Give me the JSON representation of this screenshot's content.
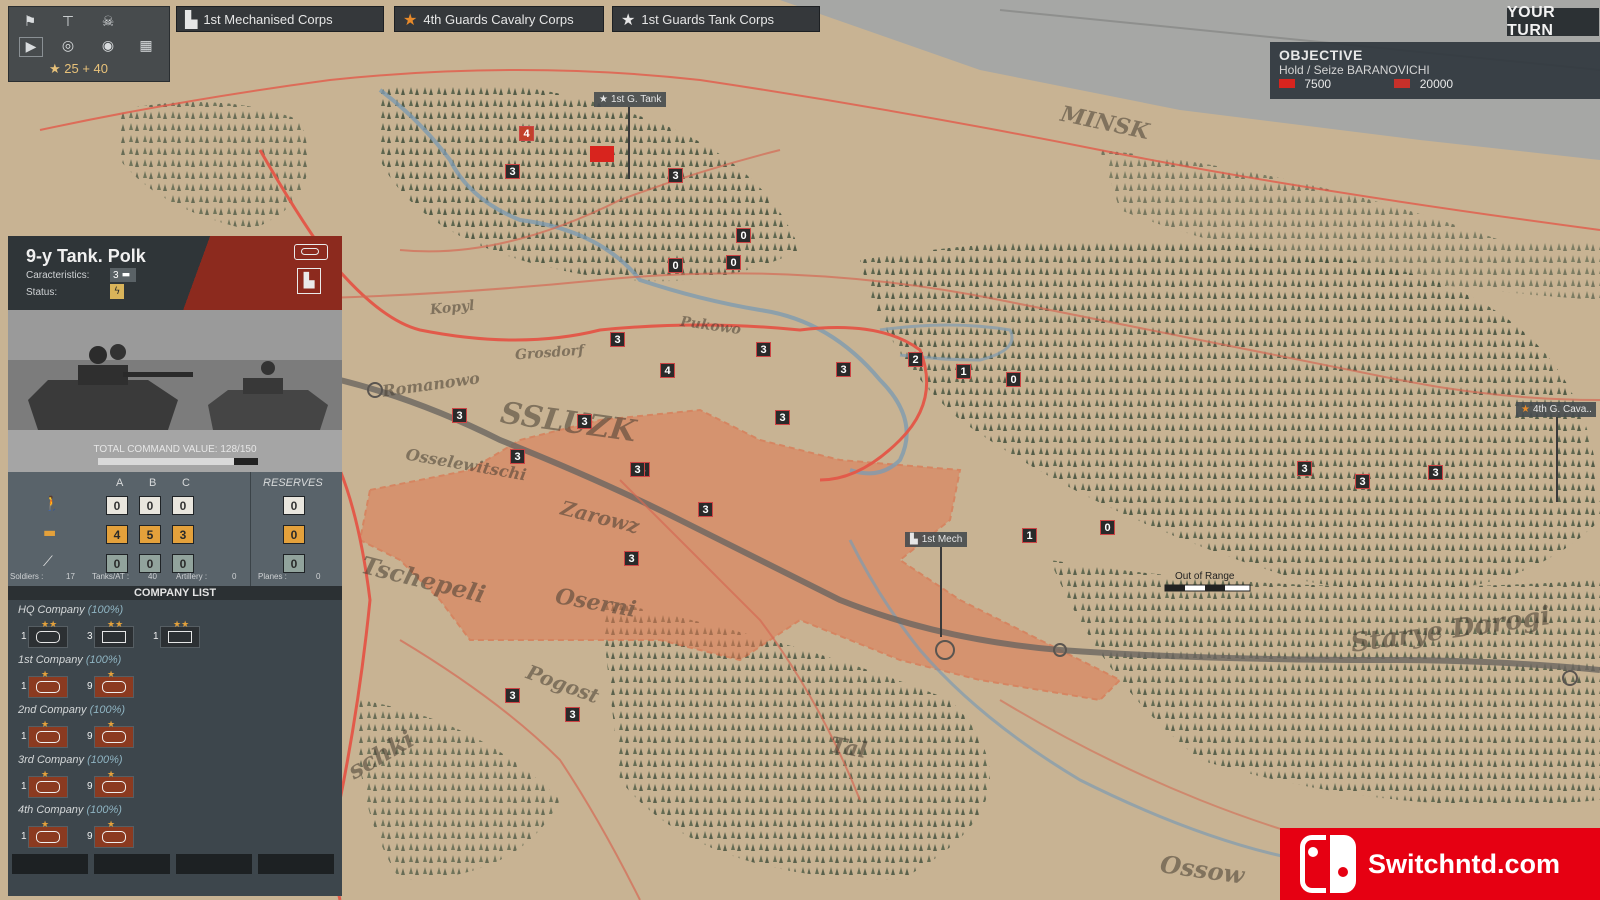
{
  "top_toolbar": {
    "icons": [
      "flag-icon",
      "org-chart-icon",
      "skull-icon",
      "play-icon",
      "eye-icon",
      "binoculars-icon",
      "grid-icon"
    ],
    "stars_label": "★ 25 + 40"
  },
  "corps_tabs": [
    {
      "label": "1st Mechanised Corps",
      "icon": "mech-corps-icon"
    },
    {
      "label": "4th Guards Cavalry Corps",
      "icon": "orange-star-icon"
    },
    {
      "label": "1st Guards Tank Corps",
      "icon": "white-star-icon"
    }
  ],
  "turn": {
    "label": "YOUR TURN"
  },
  "objective": {
    "title": "OBJECTIVE",
    "subtitle": "Hold / Seize BARANOVICHI",
    "soviet_value": "7500",
    "german_value": "20000"
  },
  "unit": {
    "name": "9-y Tank. Polk",
    "characteristics_label": "Caracteristics:",
    "characteristics_value": "3",
    "status_label": "Status:",
    "command_value_label": "TOTAL COMMAND VALUE: 128/150",
    "command_value_fraction": 0.853
  },
  "stats": {
    "columns": [
      "A",
      "B",
      "C"
    ],
    "reserves_label": "RESERVES",
    "rows": [
      {
        "type": "infantry-icon",
        "values": [
          "0",
          "0",
          "0"
        ],
        "reserve": "0",
        "style": "w"
      },
      {
        "type": "tank-icon",
        "values": [
          "4",
          "5",
          "3"
        ],
        "reserve": "0",
        "style": "o"
      },
      {
        "type": "artillery-icon",
        "values": [
          "0",
          "0",
          "0"
        ],
        "reserve": "0",
        "style": "g"
      }
    ],
    "summary": {
      "soldiers_label": "Soldiers :",
      "soldiers": "17",
      "tanks_label": "Tanks/AT :",
      "tanks": "40",
      "artillery_label": "Artillery :",
      "artillery": "0",
      "planes_label": "Planes :",
      "planes": "0"
    }
  },
  "company_list": {
    "title": "COMPANY LIST",
    "companies": [
      {
        "name": "HQ Company",
        "pct": "(100%)"
      },
      {
        "name": "1st Company",
        "pct": "(100%)"
      },
      {
        "name": "2nd Company",
        "pct": "(100%)"
      },
      {
        "name": "3rd Company",
        "pct": "(100%)"
      },
      {
        "name": "4th Company",
        "pct": "(100%)"
      }
    ],
    "hq_icons": [
      {
        "count": "1",
        "stars": "★★"
      },
      {
        "count": "3",
        "stars": "★★"
      },
      {
        "count": "1",
        "stars": "★★"
      }
    ],
    "co_icons": [
      {
        "count": "1",
        "stars": "★"
      },
      {
        "count": "9",
        "stars": "★"
      }
    ]
  },
  "map": {
    "hq_flags": [
      {
        "label": "1st G. Tank"
      },
      {
        "label": "1st Mech"
      },
      {
        "label": "4th G. Cava..."
      }
    ],
    "place_names": [
      "SSLUZK",
      "Romanowo",
      "Osselewitschi",
      "Zarowz",
      "Tschepeli",
      "Oserni",
      "Pogost",
      "Kopyl",
      "Grosdorf",
      "Pukowo",
      "Starye Dorogi",
      "MINSK",
      "Tal",
      "Ossow",
      "schki"
    ],
    "out_of_range_label": "Out of Range",
    "counters": [
      "4",
      "3",
      "3",
      "0",
      "0",
      "0",
      "3",
      "3",
      "4",
      "3",
      "2",
      "1",
      "0",
      "3",
      "3",
      "3",
      "3",
      "3",
      "3",
      "3",
      "3",
      "1",
      "0",
      "3",
      "3",
      "3",
      "3",
      "3"
    ]
  },
  "watermark": {
    "text": "Switchntd.com"
  }
}
